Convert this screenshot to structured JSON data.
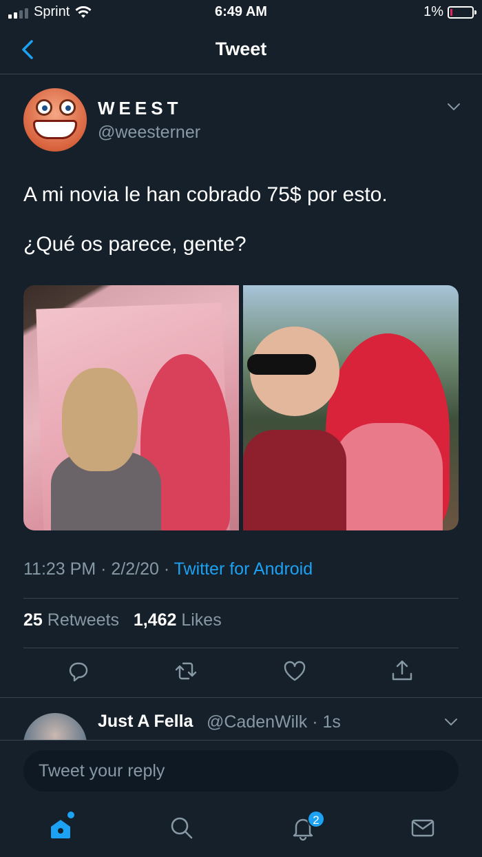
{
  "status_bar": {
    "carrier": "Sprint",
    "time": "6:49 AM",
    "battery": "1%"
  },
  "header": {
    "title": "Tweet"
  },
  "tweet": {
    "author_name": "WEEST",
    "author_handle": "@weesterner",
    "text_line1": "A mi novia le han cobrado 75$ por esto.",
    "text_line2": "¿Qué os parece, gente?",
    "time": "11:23 PM",
    "date": "2/2/20",
    "source": "Twitter for Android",
    "retweets_count": "25",
    "retweets_label": "Retweets",
    "likes_count": "1,462",
    "likes_label": "Likes"
  },
  "reply": {
    "author_name": "Just A Fella",
    "author_handle": "@CadenWilk",
    "age": "1s"
  },
  "compose": {
    "placeholder": "Tweet your reply"
  },
  "tabbar": {
    "notifications_badge": "2"
  },
  "colors": {
    "background": "#15202b",
    "accent": "#1da1f2",
    "muted": "#8899a6",
    "divider": "#38444d"
  }
}
